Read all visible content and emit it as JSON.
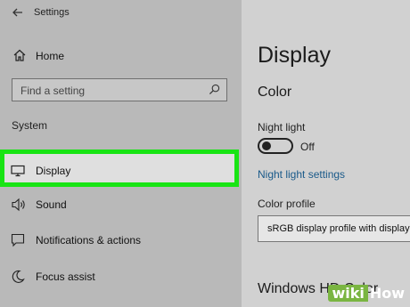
{
  "app": {
    "title": "Settings"
  },
  "sidebar": {
    "home_label": "Home",
    "search_placeholder": "Find a setting",
    "section_title": "System",
    "items": [
      {
        "label": "Display",
        "icon": "monitor-icon",
        "selected": true
      },
      {
        "label": "Sound",
        "icon": "speaker-icon"
      },
      {
        "label": "Notifications & actions",
        "icon": "notification-icon"
      },
      {
        "label": "Focus assist",
        "icon": "moon-icon"
      }
    ]
  },
  "main": {
    "title": "Display",
    "color_heading": "Color",
    "night_light_label": "Night light",
    "night_light_state": "Off",
    "night_light_link": "Night light settings",
    "color_profile_label": "Color profile",
    "color_profile_value": "sRGB display profile with display",
    "hd_color_heading": "Windows HD Color"
  },
  "watermark": {
    "part1": "wiki",
    "part2": "How"
  },
  "colors": {
    "highlight_border": "#18e414",
    "link": "#1a5a8a",
    "watermark_green": "#7ab541"
  }
}
